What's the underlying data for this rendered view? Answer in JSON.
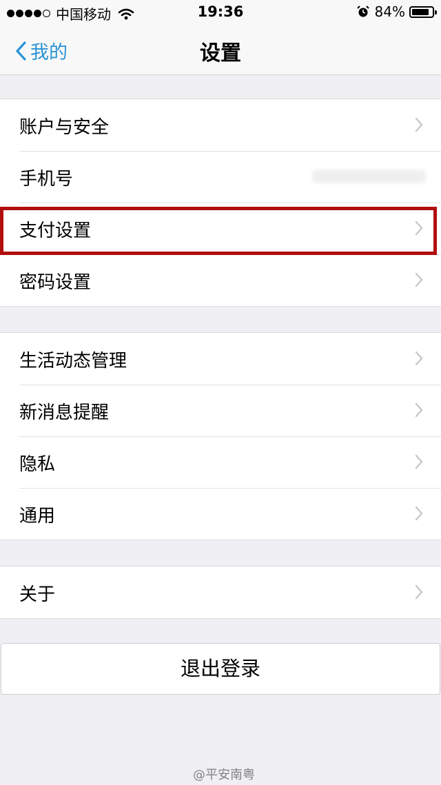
{
  "status_bar": {
    "signal_bars": 5,
    "signal_filled": 4,
    "carrier": "中国移动",
    "wifi_icon": "wifi-icon",
    "time": "19:36",
    "alarm_icon": "alarm-icon",
    "battery_percent": "84%",
    "battery_level": 0.84
  },
  "nav": {
    "back_label": "我的",
    "title": "设置"
  },
  "groups": [
    {
      "items": [
        {
          "label": "账户与安全",
          "chevron": true
        },
        {
          "label": "手机号",
          "value": "",
          "chevron": true
        },
        {
          "label": "支付设置",
          "chevron": true
        },
        {
          "label": "密码设置",
          "chevron": true
        }
      ]
    },
    {
      "items": [
        {
          "label": "生活动态管理",
          "chevron": true
        },
        {
          "label": "新消息提醒",
          "chevron": true
        },
        {
          "label": "隐私",
          "chevron": true
        },
        {
          "label": "通用",
          "chevron": true
        }
      ]
    },
    {
      "items": [
        {
          "label": "关于",
          "chevron": true
        }
      ]
    }
  ],
  "logout_label": "退出登录",
  "watermark": "@平安南粤",
  "colors": {
    "accent": "#2a93d5",
    "highlight": "#b10e0e",
    "background": "#efeff4"
  }
}
